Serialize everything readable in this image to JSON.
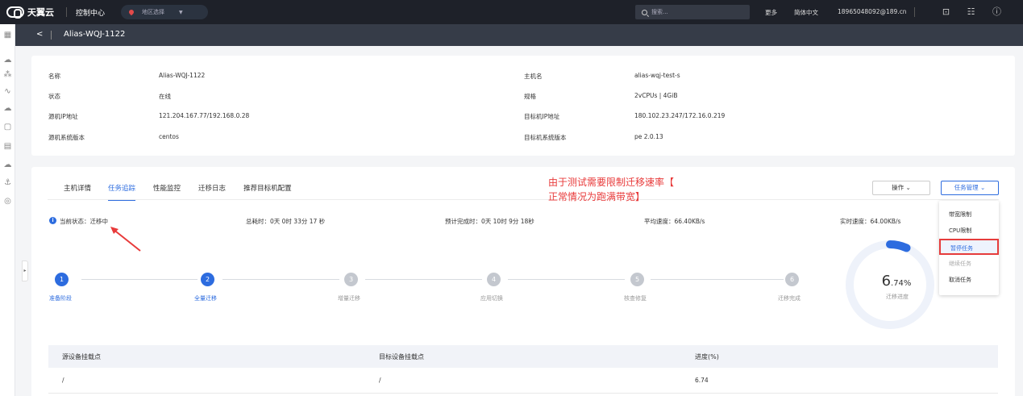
{
  "topbar": {
    "brand": "天翼云",
    "console": "控制中心",
    "region_placeholder": "地区选择",
    "search_placeholder": "搜索...",
    "more": "更多",
    "language": "简体中文",
    "account": "18965048092@189.cn"
  },
  "header": {
    "back_glyph": "<",
    "title": "Alias-WQJ-1122"
  },
  "info": {
    "name_label": "名称",
    "name_value": "Alias-WQJ-1122",
    "status_label": "状态",
    "status_value": "在线",
    "source_ip_label": "源机IP地址",
    "source_ip_value": "121.204.167.77/192.168.0.28",
    "source_os_label": "源机系统版本",
    "source_os_value": "centos",
    "hostname_label": "主机名",
    "hostname_value": "alias-wqj-test-s",
    "spec_label": "规格",
    "spec_value": "2vCPUs | 4GiB",
    "target_ip_label": "目标机IP地址",
    "target_ip_value": "180.102.23.247/172.16.0.219",
    "target_os_label": "目标机系统版本",
    "target_os_value": "pe 2.0.13"
  },
  "tabs": [
    {
      "label": "主机详情"
    },
    {
      "label": "任务追踪"
    },
    {
      "label": "性能监控"
    },
    {
      "label": "迁移日志"
    },
    {
      "label": "推荐目标机配置"
    }
  ],
  "annotation": {
    "line1": "由于测试需要限制迁移速率【",
    "line2": "正常情况为跑满带宽】"
  },
  "buttons": {
    "operations": "操作 ⌄",
    "task_management": "任务管理 ⌄"
  },
  "status": {
    "current": "当前状态：迁移中",
    "elapsed": "总耗时：0天 0时 33分 17 秒",
    "eta": "预计完成时：0天 10时 9分 18秒",
    "avg_speed": "平均速度：66.40KB/s",
    "realtime_speed": "实时速度：64.00KB/s"
  },
  "steps": [
    {
      "num": "1",
      "label": "准备阶段",
      "done": true
    },
    {
      "num": "2",
      "label": "全量迁移",
      "done": true
    },
    {
      "num": "3",
      "label": "增量迁移",
      "done": false
    },
    {
      "num": "4",
      "label": "应用切换",
      "done": false
    },
    {
      "num": "5",
      "label": "核查修复",
      "done": false
    },
    {
      "num": "6",
      "label": "迁移完成",
      "done": false
    }
  ],
  "progress": {
    "int_part": "6",
    "dec_part": ".74%",
    "label": "迁移进度",
    "value_percent": 6.74
  },
  "table": {
    "headers": [
      "源设备挂载点",
      "目标设备挂载点",
      "进度(%)"
    ],
    "rows": [
      [
        "/",
        "/",
        "6.74"
      ]
    ]
  },
  "dropdown": [
    {
      "label": "带宽限制"
    },
    {
      "label": "CPU限制"
    },
    {
      "label": "暂停任务"
    },
    {
      "label": "继续任务"
    },
    {
      "label": "取消任务"
    }
  ],
  "colors": {
    "accent": "#2d6cdf",
    "annotation": "#e83a3a",
    "topbar": "#1e2129"
  }
}
